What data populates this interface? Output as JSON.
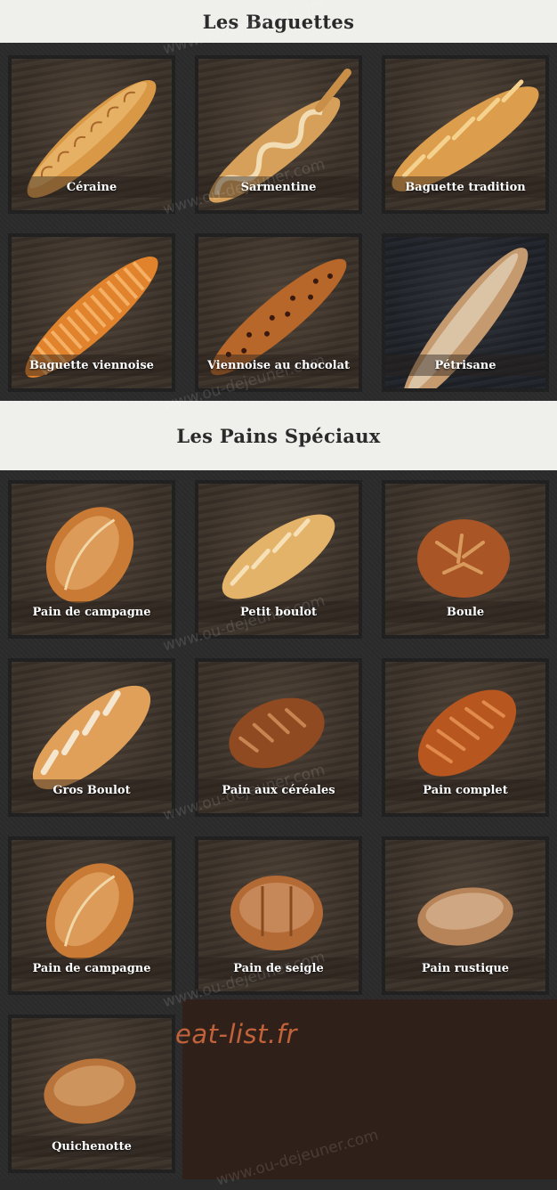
{
  "sections": {
    "baguettes": {
      "title": "Les Baguettes",
      "items": [
        {
          "label": "Céraine",
          "icon": "baguette-icon"
        },
        {
          "label": "Sarmentine",
          "icon": "baguette-icon"
        },
        {
          "label": "Baguette tradition",
          "icon": "baguette-icon"
        },
        {
          "label": "Baguette viennoise",
          "icon": "baguette-icon"
        },
        {
          "label": "Viennoise au chocolat",
          "icon": "baguette-icon"
        },
        {
          "label": "Pétrisane",
          "icon": "baguette-icon"
        }
      ]
    },
    "pains": {
      "title": "Les Pains Spéciaux",
      "items": [
        {
          "label": "Pain de campagne",
          "icon": "loaf-icon"
        },
        {
          "label": "Petit boulot",
          "icon": "loaf-icon"
        },
        {
          "label": "Boule",
          "icon": "round-loaf-icon"
        },
        {
          "label": "Gros Boulot",
          "icon": "loaf-icon"
        },
        {
          "label": "Pain aux céréales",
          "icon": "loaf-icon"
        },
        {
          "label": "Pain complet",
          "icon": "loaf-icon"
        },
        {
          "label": "Pain de campagne",
          "icon": "loaf-icon"
        },
        {
          "label": "Pain de seigle",
          "icon": "round-loaf-icon"
        },
        {
          "label": "Pain rustique",
          "icon": "loaf-icon"
        },
        {
          "label": "Quichenotte",
          "icon": "loaf-icon"
        }
      ]
    }
  },
  "brand": "eat-list.fr",
  "watermark": "www.ou-dejeuner.com",
  "colors": {
    "accent": "#c2623a",
    "heading_bg": "#efefec",
    "page_bg": "#2b2b2b"
  }
}
